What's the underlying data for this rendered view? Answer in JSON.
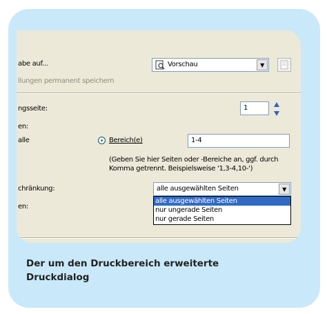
{
  "dialog": {
    "output_label": "abe auf...",
    "output_select": {
      "value": "Vorschau",
      "icon": "print-preview-icon"
    },
    "save_permanent_label": "llungen permanent speichern",
    "page_label": "ngsseite:",
    "page_value": "1",
    "range_header": "en:",
    "all_label": "alle",
    "range_radio_label": "Bereich(e)",
    "range_value": "1-4",
    "range_hint_line1": "(Geben Sie hier Seiten oder -Bereiche an, ggf. durch",
    "range_hint_line2": "Komma getrennt. Beispielsweise '1,3-4,10-')",
    "restriction_label": "chränkung:",
    "restriction_select": {
      "value": "alle ausgewählten Seiten",
      "options": [
        "alle ausgewählten Seiten",
        "nur ungerade Seiten",
        "nur gerade Seiten"
      ],
      "selected_index": 0
    },
    "copies_label": "en:"
  },
  "caption_line1": "Der um den Druckbereich erweiterte",
  "caption_line2": "Druckdialog",
  "colors": {
    "card_bg": "#c9e9fa",
    "dialog_bg": "#ece9d8",
    "highlight": "#316ac5"
  }
}
